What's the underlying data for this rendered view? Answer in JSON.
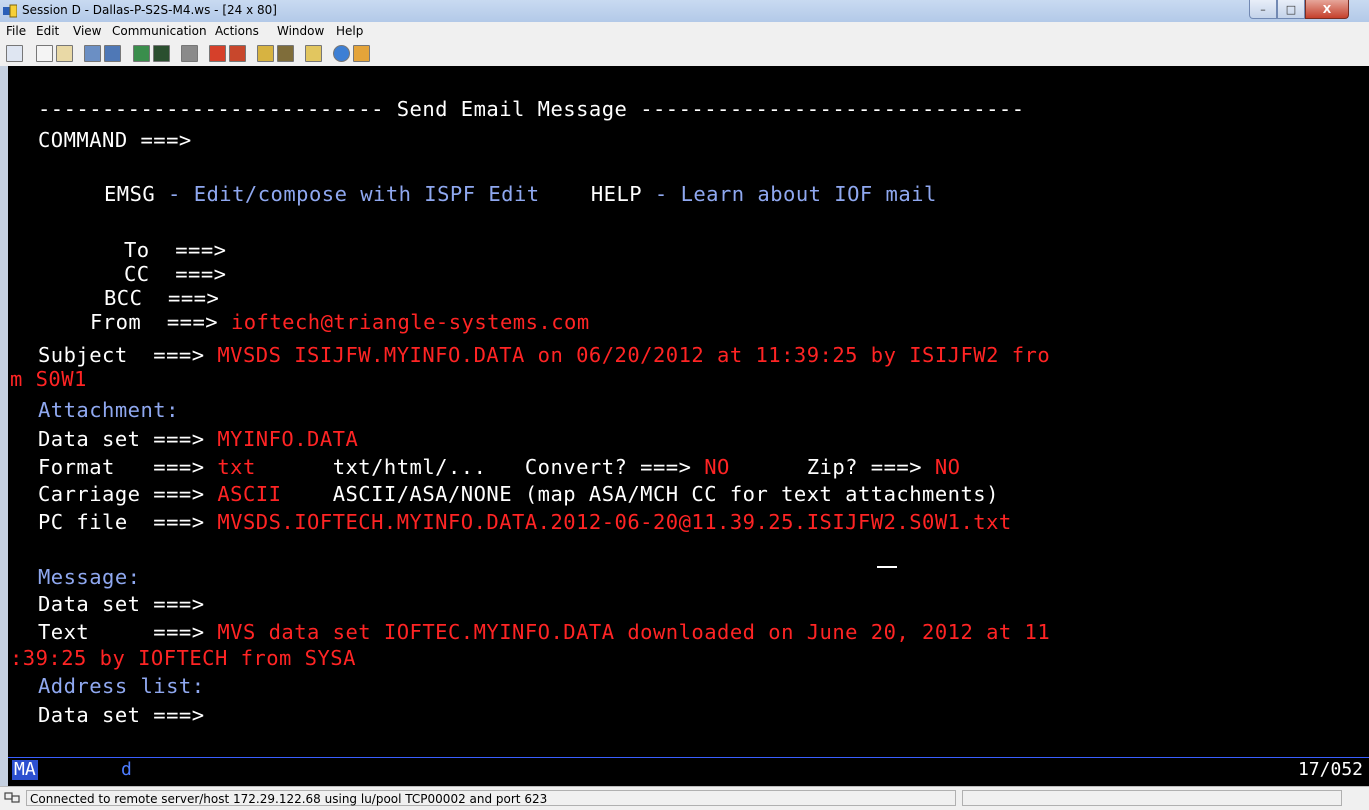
{
  "window": {
    "title": "Session D - Dallas-P-S2S-M4.ws - [24 x 80]",
    "minimize": "–",
    "maximize": "□",
    "close": "X"
  },
  "menu": [
    "File",
    "Edit",
    "View",
    "Communication",
    "Actions",
    "Window",
    "Help"
  ],
  "toolbar": {
    "icons": [
      "print-screen-icon",
      "copy-icon",
      "paste-icon",
      "send-file-icon",
      "receive-file-icon",
      "keypad-icon",
      "display-icon",
      "record-macro-icon",
      "play-macro-icon",
      "stop-macro-icon",
      "connect-icon",
      "disconnect-icon",
      "clipboard-icon",
      "globe-icon",
      "edit-icon"
    ]
  },
  "screen": {
    "header_dashes_left": "---------------------------",
    "header_title": " Send Email Message ",
    "header_dashes_right": "------------------------------",
    "command_label": "COMMAND ===>",
    "emsg_key": "EMSG",
    "emsg_sep": " - ",
    "emsg_desc": "Edit/compose with ISPF Edit",
    "help_key": "HELP",
    "help_sep": " - ",
    "help_desc": "Learn about IOF mail",
    "to_label": "To  ===>",
    "cc_label": "CC  ===>",
    "bcc_label": "BCC  ===>",
    "from_label": "From  ===>",
    "from_value": "ioftech@triangle-systems.com",
    "subject_label": "Subject  ===>",
    "subject_value": "MVSDS ISIJFW.MYINFO.DATA on 06/20/2012 at 11:39:25 by ISIJFW2 fro",
    "subject_value_cont": "m S0W1",
    "attachment_heading": "Attachment:",
    "att_dataset_label": "Data set ===>",
    "att_dataset_value": "MYINFO.DATA",
    "format_label": "Format   ===>",
    "format_value": "txt",
    "format_hint": "txt/html/...",
    "convert_label": "Convert? ===>",
    "convert_value": "NO",
    "zip_label": "Zip? ===>",
    "zip_value": "NO",
    "carriage_label": "Carriage ===>",
    "carriage_value": "ASCII",
    "carriage_hint": "ASCII/ASA/NONE (map ASA/MCH CC for text attachments)",
    "pcfile_label": "PC file  ===>",
    "pcfile_value": "MVSDS.IOFTECH.MYINFO.DATA.2012-06-20@11.39.25.ISIJFW2.S0W1.txt",
    "message_heading": "Message:",
    "msg_dataset_label": "Data set ===>",
    "text_label": "Text     ===>",
    "text_value": "MVS data set IOFTEC.MYINFO.DATA downloaded on June 20, 2012 at 11",
    "text_value_cont": ":39:25 by IOFTECH from SYSA",
    "address_heading": "Address list:",
    "addr_dataset_label": "Data set ===>"
  },
  "oia": {
    "mode": "MA",
    "indicator": "d",
    "cursor_position": "17/052"
  },
  "status": {
    "text": "Connected to remote server/host 172.29.122.68 using lu/pool TCP00002 and port 623"
  }
}
